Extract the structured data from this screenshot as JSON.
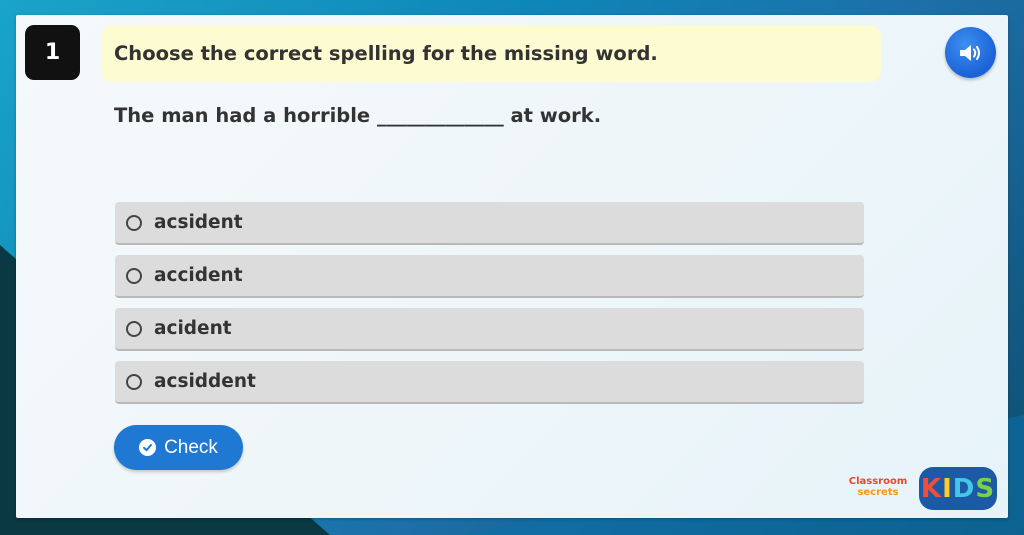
{
  "question": {
    "number": "1",
    "instruction": "Choose the correct spelling for the missing word.",
    "sentence_before": "The man had a horrible ",
    "blank": "_____________",
    "sentence_after": " at work."
  },
  "options": [
    {
      "label": "acsident",
      "selected": false
    },
    {
      "label": "accident",
      "selected": false
    },
    {
      "label": "acident",
      "selected": false
    },
    {
      "label": "acsiddent",
      "selected": false
    }
  ],
  "check_button": {
    "label": "Check"
  },
  "icons": {
    "audio": "speaker-icon",
    "check": "checkmark-circle-icon"
  },
  "branding": {
    "classroom": "Classroom",
    "secrets": "secrets",
    "kids": [
      "K",
      "I",
      "D",
      "S"
    ]
  },
  "colors": {
    "prompt_bg": "#fdfbd2",
    "button_blue": "#1f78d1",
    "option_bg": "#dcdcdc"
  }
}
